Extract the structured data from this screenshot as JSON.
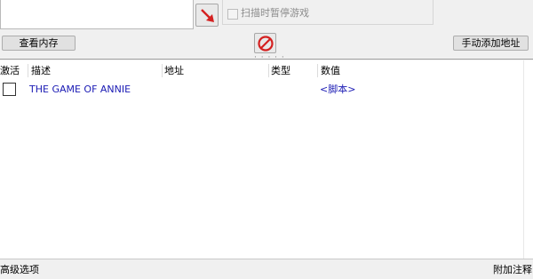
{
  "process": {
    "pause_game_label": "扫描时暂停游戏"
  },
  "toolbar": {
    "view_memory_label": "查看内存",
    "add_address_label": "手动添加地址"
  },
  "table": {
    "columns": [
      "激活",
      "描述",
      "地址",
      "类型",
      "数值"
    ],
    "rows": [
      {
        "active": false,
        "description": "THE GAME OF ANNIE",
        "address": "",
        "type": "",
        "value": "<脚本>"
      }
    ]
  },
  "status_bar": {
    "left_label": "高级选项",
    "right_label": "附加注释"
  },
  "colors": {
    "entry_text": "#1b1bb4",
    "disabled_text": "#8c8c8c",
    "window_bg": "#f0f0f0"
  },
  "icons": {
    "select_process": "red-arrow-icon",
    "stop_scan": "stop-circle-icon"
  }
}
